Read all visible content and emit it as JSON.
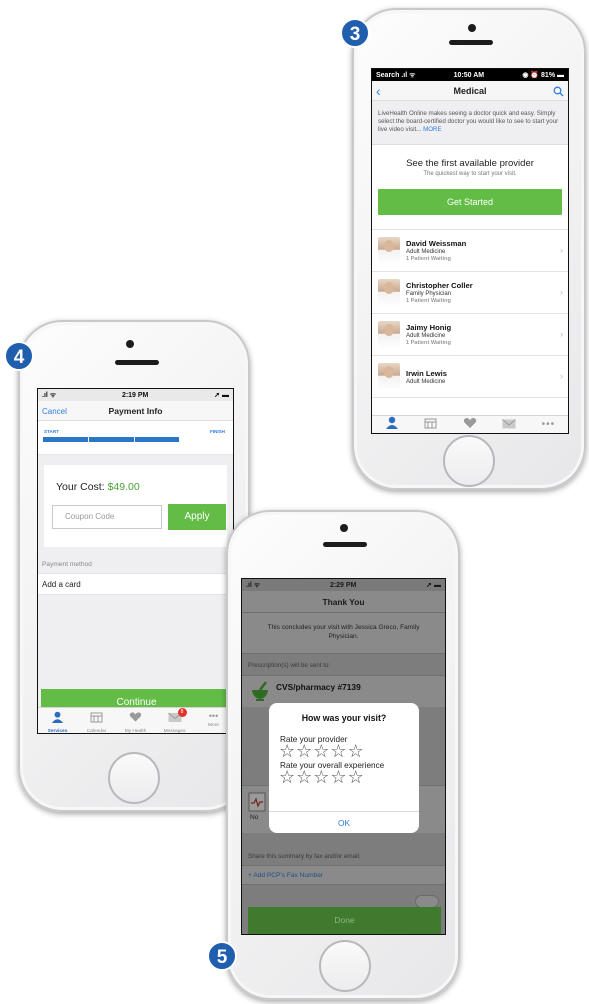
{
  "badges": {
    "step3": "3",
    "step4": "4",
    "step5": "5"
  },
  "screen3": {
    "status": {
      "left": "Search",
      "time": "10:50 AM",
      "battery": "81%"
    },
    "title": "Medical",
    "intro": "LiveHealth Online makes seeing a doctor quick and easy. Simply select the board-certified doctor you would like to see to start your live video visit...",
    "more": "MORE",
    "first_provider_heading": "See the first available provider",
    "first_provider_sub": "The quickest way to start your visit.",
    "get_started": "Get Started",
    "providers": [
      {
        "name": "David Weissman",
        "specialty": "Adult Medicine",
        "waiting": "1 Patient Waiting"
      },
      {
        "name": "Christopher Coller",
        "specialty": "Family Physician",
        "waiting": "1 Patient Waiting"
      },
      {
        "name": "Jaimy Honig",
        "specialty": "Adult Medicine",
        "waiting": "1 Patient Waiting"
      },
      {
        "name": "Irwin Lewis",
        "specialty": "Adult Medicine",
        "waiting": ""
      }
    ]
  },
  "screen4": {
    "status": {
      "time": "2:19 PM"
    },
    "cancel": "Cancel",
    "title": "Payment Info",
    "progress_start": "START",
    "progress_finish": "FINISH",
    "cost_label": "Your Cost:",
    "cost_amount": "$49.00",
    "coupon_placeholder": "Coupon Code",
    "apply": "Apply",
    "payment_method_header": "Payment method",
    "add_card": "Add a card",
    "continue": "Continue",
    "tabs": [
      {
        "label": "Services"
      },
      {
        "label": "Calendar"
      },
      {
        "label": "My Health"
      },
      {
        "label": "Messages",
        "badge": "8"
      },
      {
        "label": "More"
      }
    ]
  },
  "screen5": {
    "status": {
      "time": "2:29 PM"
    },
    "title": "Thank You",
    "conclusion": "This concludes your visit with Jessica Greco, Family Physician.",
    "rx_sent": "Prescription(s) will be sent to:",
    "pharmacy": "CVS/pharmacy #7139",
    "partial_text": "No",
    "share": "Share this summary by fax and/or email.",
    "add_fax": "+ Add PCP's Fax Number",
    "done": "Done",
    "modal": {
      "title": "How was your visit?",
      "rate_provider": "Rate your provider",
      "rate_experience": "Rate your overall experience",
      "ok": "OK"
    }
  },
  "colors": {
    "accent_green": "#63bc46",
    "link_blue": "#2f7de1",
    "badge_blue": "#1f5fae"
  }
}
